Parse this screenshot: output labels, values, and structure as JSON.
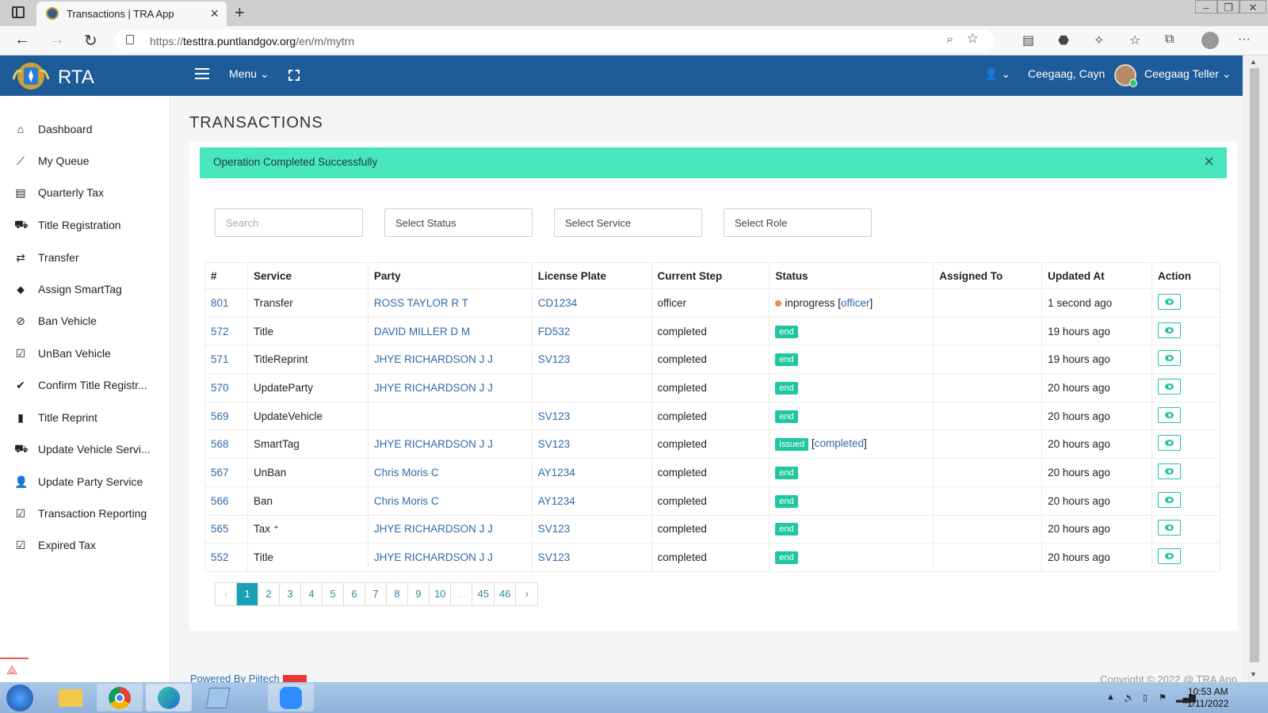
{
  "browser": {
    "tab_title": "Transactions | TRA App",
    "url_prefix": "https://",
    "url_domain": "testtra.puntlandgov.org",
    "url_path": "/en/m/mytrn"
  },
  "header": {
    "brand": "RTA",
    "menu_label": "Menu",
    "user_role": "Ceegaag, Cayn",
    "user_name": "Ceegaag Teller"
  },
  "sidebar": {
    "items": [
      {
        "label": "Dashboard",
        "icon": "home-icon"
      },
      {
        "label": "My Queue",
        "icon": "chart-line-icon"
      },
      {
        "label": "Quarterly Tax",
        "icon": "table-icon"
      },
      {
        "label": "Title Registration",
        "icon": "car-icon"
      },
      {
        "label": "Transfer",
        "icon": "exchange-icon"
      },
      {
        "label": "Assign SmartTag",
        "icon": "tags-icon"
      },
      {
        "label": "Ban Vehicle",
        "icon": "ban-icon"
      },
      {
        "label": "UnBan Vehicle",
        "icon": "check-square-icon"
      },
      {
        "label": "Confirm Title Registr...",
        "icon": "check-icon"
      },
      {
        "label": "Title Reprint",
        "icon": "file-icon"
      },
      {
        "label": "Update Vehicle Servi...",
        "icon": "car-icon"
      },
      {
        "label": "Update Party Service",
        "icon": "user-icon"
      },
      {
        "label": "Transaction Reporting",
        "icon": "check-square-icon"
      },
      {
        "label": "Expired Tax",
        "icon": "check-square-icon"
      }
    ]
  },
  "page": {
    "title": "TRANSACTIONS",
    "alert": "Operation Completed Successfully"
  },
  "filters": {
    "search_placeholder": "Search",
    "status": "Select Status",
    "service": "Select Service",
    "role": "Select Role"
  },
  "table": {
    "headers": [
      "#",
      "Service",
      "Party",
      "License Plate",
      "Current Step",
      "Status",
      "Assigned To",
      "Updated At",
      "Action"
    ],
    "rows": [
      {
        "id": "801",
        "service": "Transfer",
        "party": "ROSS TAYLOR R T",
        "plate": "CD1234",
        "step": "officer",
        "status": "inprogress",
        "status_type": "dot",
        "status_ref": "officer",
        "assigned": "",
        "updated": "1 second ago"
      },
      {
        "id": "572",
        "service": "Title",
        "party": "DAVID MILLER D M",
        "plate": "FD532",
        "step": "completed",
        "status": "end",
        "status_type": "badge",
        "status_ref": "",
        "assigned": "",
        "updated": "19 hours ago"
      },
      {
        "id": "571",
        "service": "TitleReprint",
        "party": "JHYE RICHARDSON J J",
        "plate": "SV123",
        "step": "completed",
        "status": "end",
        "status_type": "badge",
        "status_ref": "",
        "assigned": "",
        "updated": "19 hours ago"
      },
      {
        "id": "570",
        "service": "UpdateParty",
        "party": "JHYE RICHARDSON J J",
        "plate": "",
        "step": "completed",
        "status": "end",
        "status_type": "badge",
        "status_ref": "",
        "assigned": "",
        "updated": "20 hours ago"
      },
      {
        "id": "569",
        "service": "UpdateVehicle",
        "party": "",
        "plate": "SV123",
        "step": "completed",
        "status": "end",
        "status_type": "badge",
        "status_ref": "",
        "assigned": "",
        "updated": "20 hours ago"
      },
      {
        "id": "568",
        "service": "SmartTag",
        "party": "JHYE RICHARDSON J J",
        "plate": "SV123",
        "step": "completed",
        "status": "issued",
        "status_type": "badge",
        "status_ref": "completed",
        "assigned": "",
        "updated": "20 hours ago"
      },
      {
        "id": "567",
        "service": "UnBan",
        "party": "Chris Moris C",
        "plate": "AY1234",
        "step": "completed",
        "status": "end",
        "status_type": "badge",
        "status_ref": "",
        "assigned": "",
        "updated": "20 hours ago"
      },
      {
        "id": "566",
        "service": "Ban",
        "party": "Chris Moris C",
        "plate": "AY1234",
        "step": "completed",
        "status": "end",
        "status_type": "badge",
        "status_ref": "",
        "assigned": "",
        "updated": "20 hours ago"
      },
      {
        "id": "565",
        "service": "Tax ⁺",
        "party": "JHYE RICHARDSON J J",
        "plate": "SV123",
        "step": "completed",
        "status": "end",
        "status_type": "badge",
        "status_ref": "",
        "assigned": "",
        "updated": "20 hours ago"
      },
      {
        "id": "552",
        "service": "Title",
        "party": "JHYE RICHARDSON J J",
        "plate": "SV123",
        "step": "completed",
        "status": "end",
        "status_type": "badge",
        "status_ref": "",
        "assigned": "",
        "updated": "20 hours ago"
      }
    ]
  },
  "pagination": {
    "prev": "‹",
    "pages": [
      "1",
      "2",
      "3",
      "4",
      "5",
      "6",
      "7",
      "8",
      "9",
      "10",
      "...",
      "45",
      "46"
    ],
    "active": "1",
    "next": "›"
  },
  "footer": {
    "powered_by": "Powered By Pijtech",
    "copyright": "Copyright © 2022 @ TRA App"
  },
  "taskbar": {
    "time": "10:53 AM",
    "date": "1/11/2022"
  },
  "colors": {
    "header_bg": "#1e5b99",
    "alert_bg": "#47e6bd",
    "badge_bg": "#1fc7a0",
    "link": "#2e6aa8"
  }
}
